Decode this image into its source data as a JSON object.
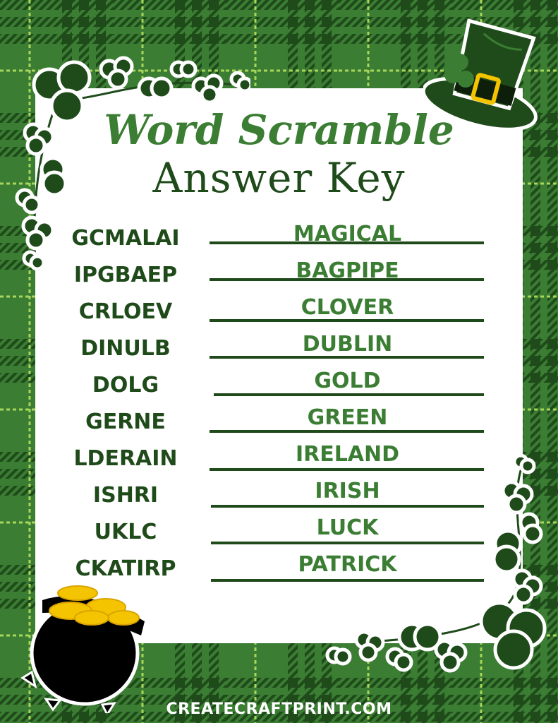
{
  "title": {
    "line1": "Word Scramble",
    "line2": "Answer Key"
  },
  "rows": [
    {
      "scrambled": "GCMALAI",
      "answer": "MAGICAL"
    },
    {
      "scrambled": "IPGBAEP",
      "answer": "BAGPIPE"
    },
    {
      "scrambled": "CRLOEV",
      "answer": "CLOVER"
    },
    {
      "scrambled": "DINULB",
      "answer": "DUBLIN"
    },
    {
      "scrambled": "DOLG",
      "answer": "GOLD"
    },
    {
      "scrambled": "GERNE",
      "answer": "GREEN"
    },
    {
      "scrambled": "LDERAIN",
      "answer": "IRELAND"
    },
    {
      "scrambled": "ISHRI",
      "answer": "IRISH"
    },
    {
      "scrambled": "UKLC",
      "answer": "LUCK"
    },
    {
      "scrambled": "CKATIRP",
      "answer": "PATRICK"
    }
  ],
  "footer": "CREATECRAFTPRINT.COM",
  "decorations": [
    "plaid-background",
    "shamrock-vine-top-left",
    "leprechaun-hat",
    "shamrock-vine-bottom-right",
    "pot-of-gold"
  ],
  "colors": {
    "plaid_base": "#3a7d33",
    "plaid_dark": "#1f4a1a",
    "plaid_accent": "#a8d65a",
    "title_light": "#3a7d33",
    "title_dark": "#1f4a1a",
    "gold": "#f5c400"
  }
}
